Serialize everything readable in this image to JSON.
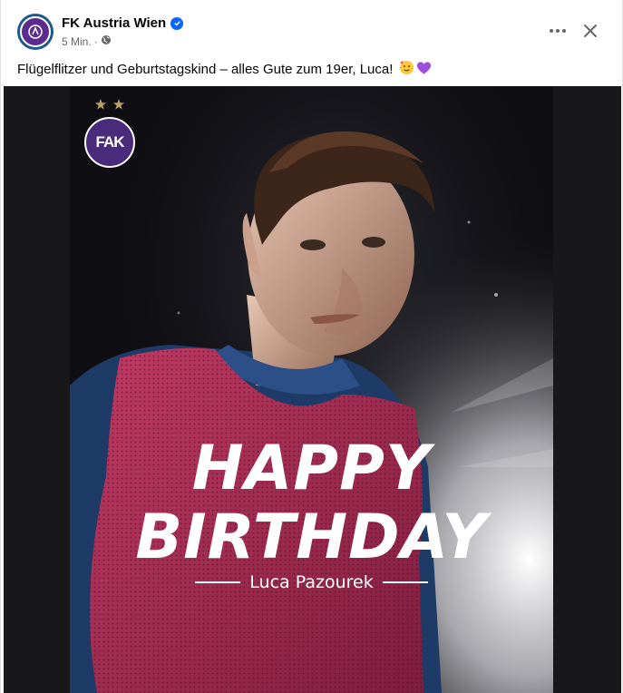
{
  "post": {
    "page_name": "FK Austria Wien",
    "time": "5 Min.",
    "separator": "·",
    "text": "Flügelflitzer und Geburtstagskind – alles Gute zum 19er, Luca!"
  },
  "graphic": {
    "line1": "HAPPY",
    "line2": "BIRTHDAY",
    "player_name": "Luca Pazourek",
    "club_badge_text": "FAK"
  },
  "icons": {
    "verified": "verified-badge-icon",
    "audience": "globe-icon",
    "more": "more-options-icon",
    "close": "close-icon",
    "emoji1": "partying-face-emoji",
    "emoji2": "purple-heart-emoji"
  },
  "colors": {
    "club_purple": "#5b2b8f",
    "verified_blue": "#0866ff",
    "jersey_pink": "#b8345d"
  }
}
